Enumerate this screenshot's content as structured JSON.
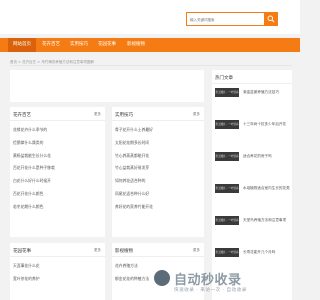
{
  "search": {
    "placeholder": "输入关键词搜索"
  },
  "nav": [
    {
      "label": "网站首页"
    },
    {
      "label": "花卉百艺"
    },
    {
      "label": "实用技巧"
    },
    {
      "label": "花园花事"
    },
    {
      "label": "影视植物"
    }
  ],
  "breadcrumb": "首页 > 花卉百艺 > 吊竹梅的养殖方法和注意事项图解",
  "boxes": [
    {
      "title": "花卉百艺",
      "more": "更多",
      "items": [
        "花缘花卉什么季节的",
        "捡鹅掌什么属类的",
        "黄杨盆栽能生长什么花",
        "百花开花什么是种子移栽",
        "白花什么好什么时候开",
        "百花开花什么颜色",
        "若冬花期什么颜色"
      ]
    },
    {
      "title": "实用技巧",
      "more": "更多",
      "items": [
        "骨子花开什么土养最好",
        "太阳花花期多长时间",
        "竹心养蒸蒸都能开花",
        "竹心盆栽蒸好易发芽",
        "如何养花适合种的",
        "凤尾花适合种什么好",
        "养好花的家养竹能开花"
      ]
    },
    {
      "title": "花园花事",
      "more": "更多",
      "items": [
        "天涯事花什么花",
        "宽叶茶花的养护"
      ]
    },
    {
      "title": "影视植物",
      "more": "更多",
      "items": [
        "花卉养殖方法",
        "郁金花花的种植方法"
      ]
    }
  ],
  "sidebar": {
    "title": "热门文章",
    "thumb_label": "暂无图片 · 一叶轻舟",
    "items": [
      "菊金盆景养殖方法技巧",
      "十三年树十缸多少年后开花",
      "适合养花的房子吗",
      "水培植物适合室内生长的花类",
      "天堂鸟养殖方法和注意事项",
      "长寿花能开几个月吗"
    ]
  },
  "watermark": {
    "big": "自动秒收录",
    "small": "快速收录 · 来访一次 · 自动收录"
  }
}
